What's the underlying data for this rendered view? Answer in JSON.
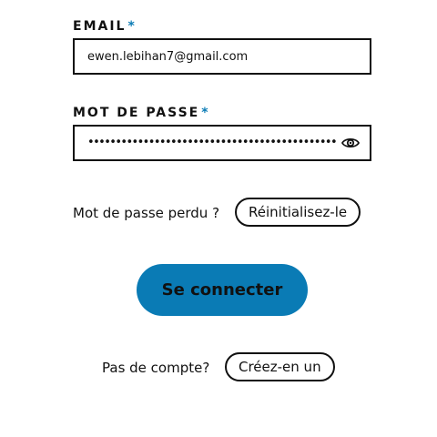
{
  "form": {
    "email": {
      "label": "EMAIL",
      "required_mark": "*",
      "value": "ewen.lebihan7@gmail.com"
    },
    "password": {
      "label": "MOT DE PASSE",
      "required_mark": "*",
      "masked_value": "•••••••••••••••••••••••••••••••••••••••••••••••••••••••••",
      "toggle_icon": "eye-icon"
    },
    "forgot": {
      "text": "Mot de passe perdu ?",
      "link_label": "Réinitialisez-le"
    },
    "submit_label": "Se connecter",
    "signup": {
      "text": "Pas de compte?",
      "link_label": "Créez-en un"
    }
  },
  "colors": {
    "accent": "#0a7bb5",
    "text": "#111111",
    "border": "#111111",
    "background": "#ffffff"
  }
}
